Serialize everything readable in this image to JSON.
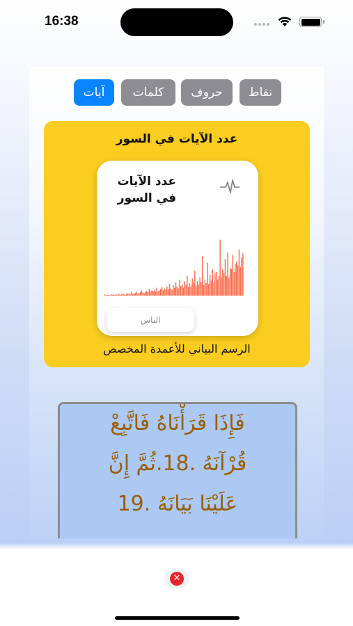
{
  "status_bar": {
    "time": "16:38"
  },
  "tabs": [
    {
      "label": "نقاط",
      "active": false
    },
    {
      "label": "حروف",
      "active": false
    },
    {
      "label": "كلمات",
      "active": false
    },
    {
      "label": "آيات",
      "active": true
    }
  ],
  "chart_card": {
    "title": "عدد الآيات في السور",
    "widget_title_line1": "عدد الآيات",
    "widget_title_line2": "في السور",
    "widget_icon": "waveform-icon",
    "tooltip": "الناس",
    "caption": "الرسم البياني للأعمدة المخصص",
    "background_color": "#fbcd21",
    "bar_color": "#ff6b4a"
  },
  "chart_data": {
    "type": "bar",
    "title": "عدد الآيات في السور",
    "values": [
      2,
      1,
      1,
      1,
      1,
      2,
      1,
      2,
      1,
      2,
      1,
      3,
      1,
      2,
      2,
      3,
      1,
      2,
      4,
      3,
      2,
      5,
      3,
      3,
      4,
      6,
      3,
      4,
      5,
      8,
      5,
      4,
      6,
      7,
      5,
      10,
      6,
      8,
      7,
      9,
      6,
      12,
      7,
      8,
      10,
      13,
      8,
      11,
      9,
      14,
      10,
      18,
      11,
      9,
      16,
      12,
      20,
      14,
      11,
      24,
      15,
      17,
      12,
      22,
      16,
      30,
      13,
      19,
      14,
      26,
      20,
      38,
      15,
      22,
      17,
      28,
      21,
      60,
      16,
      24,
      19,
      50,
      18,
      32,
      23,
      40,
      20,
      34,
      36,
      24,
      30,
      85,
      28,
      40,
      34,
      56,
      30,
      66,
      27,
      42,
      40,
      62,
      36,
      48,
      52,
      46,
      70,
      44,
      58,
      64
    ],
    "ylim": [
      0,
      110
    ]
  },
  "verse": {
    "line1": "فَإِذَا قَرَأْنَاهُ فَاتَّبِعْ",
    "line2": "قُرْآنَهُ .18.ثُمَّ إِنَّ",
    "line3": "عَلَيْنَا بَيَانَهُ .19",
    "text_color": "#9a5e08"
  },
  "bottom": {
    "close_icon": "close-icon",
    "close_glyph": "✕"
  }
}
